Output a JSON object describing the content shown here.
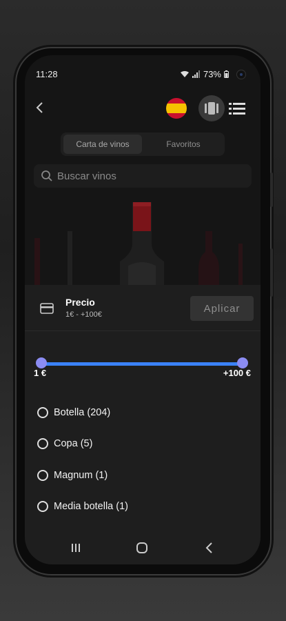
{
  "status": {
    "time": "11:28",
    "battery": "73%"
  },
  "topbar": {
    "back_icon": "chevron-left-icon",
    "flag_icon": "spain-flag-icon",
    "view_icons": [
      "grid-view-icon",
      "list-view-icon"
    ]
  },
  "tabs": [
    {
      "label": "Carta de vinos",
      "active": true
    },
    {
      "label": "Favoritos",
      "active": false
    }
  ],
  "search": {
    "placeholder": "Buscar vinos",
    "value": ""
  },
  "filter": {
    "title": "Precio",
    "subtitle": "1€ - +100€",
    "apply_label": "Aplicar",
    "slider": {
      "min_label": "1 €",
      "max_label": "+100 €",
      "low_fraction": 0,
      "high_fraction": 1,
      "accent": "#3b82f6"
    },
    "options": [
      {
        "label": "Botella (204)",
        "checked": false
      },
      {
        "label": "Copa (5)",
        "checked": false
      },
      {
        "label": "Magnum (1)",
        "checked": false
      },
      {
        "label": "Media botella (1)",
        "checked": false
      }
    ]
  },
  "nav": {
    "icons": [
      "recents-icon",
      "home-icon",
      "back-icon"
    ]
  }
}
